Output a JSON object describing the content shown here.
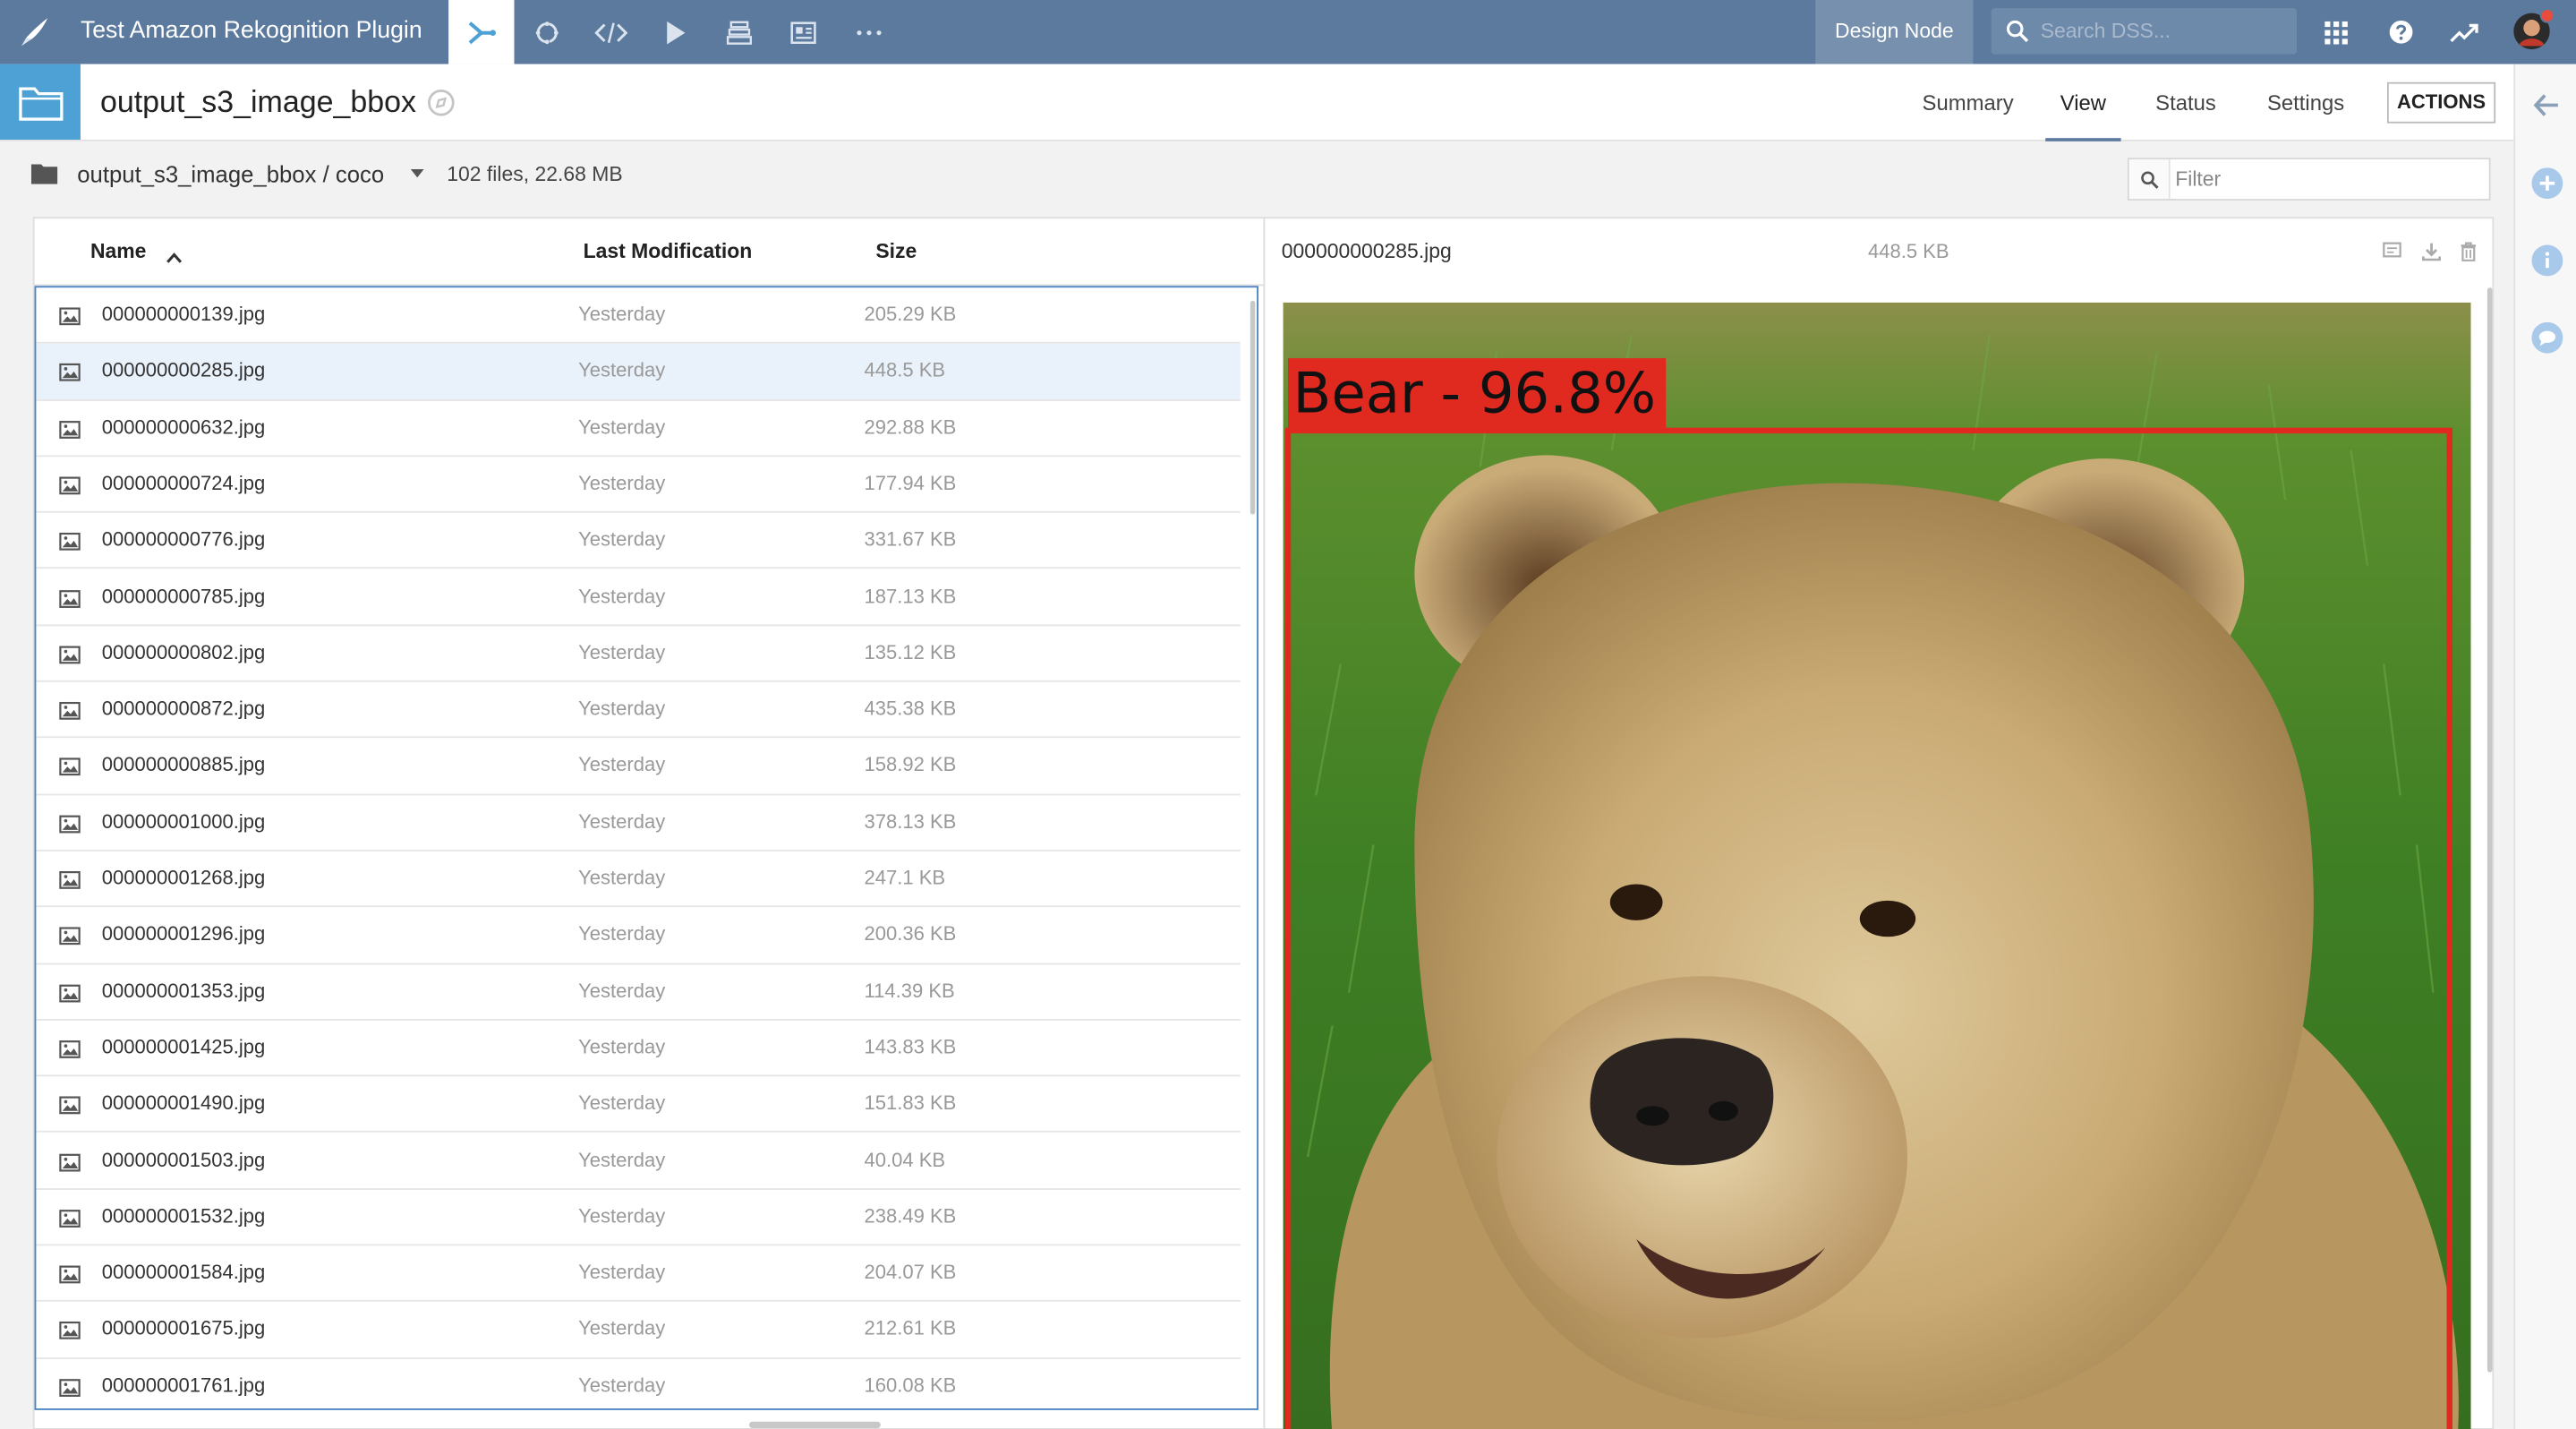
{
  "topbar": {
    "project_title": "Test Amazon Rekognition Plugin",
    "nav_icons": [
      "flow-icon",
      "recycle-icon",
      "code-icon",
      "play-icon",
      "stack-icon",
      "dashboard-icon",
      "more-icon"
    ],
    "design_node": "Design Node",
    "search_placeholder": "Search DSS..."
  },
  "header": {
    "title": "output_s3_image_bbox",
    "tabs": [
      {
        "label": "Summary"
      },
      {
        "label": "View"
      },
      {
        "label": "Status"
      },
      {
        "label": "Settings"
      }
    ],
    "active_tab": "View",
    "actions_label": "ACTIONS"
  },
  "pathbar": {
    "path": "output_s3_image_bbox / coco",
    "file_count": "102 files, 22.68 MB",
    "filter_placeholder": "Filter"
  },
  "list": {
    "columns": {
      "name": "Name",
      "last_modification": "Last Modification",
      "size": "Size"
    },
    "selected_index": 1,
    "files": [
      {
        "name": "000000000139.jpg",
        "modified": "Yesterday",
        "size": "205.29 KB"
      },
      {
        "name": "000000000285.jpg",
        "modified": "Yesterday",
        "size": "448.5 KB"
      },
      {
        "name": "000000000632.jpg",
        "modified": "Yesterday",
        "size": "292.88 KB"
      },
      {
        "name": "000000000724.jpg",
        "modified": "Yesterday",
        "size": "177.94 KB"
      },
      {
        "name": "000000000776.jpg",
        "modified": "Yesterday",
        "size": "331.67 KB"
      },
      {
        "name": "000000000785.jpg",
        "modified": "Yesterday",
        "size": "187.13 KB"
      },
      {
        "name": "000000000802.jpg",
        "modified": "Yesterday",
        "size": "135.12 KB"
      },
      {
        "name": "000000000872.jpg",
        "modified": "Yesterday",
        "size": "435.38 KB"
      },
      {
        "name": "000000000885.jpg",
        "modified": "Yesterday",
        "size": "158.92 KB"
      },
      {
        "name": "000000001000.jpg",
        "modified": "Yesterday",
        "size": "378.13 KB"
      },
      {
        "name": "000000001268.jpg",
        "modified": "Yesterday",
        "size": "247.1 KB"
      },
      {
        "name": "000000001296.jpg",
        "modified": "Yesterday",
        "size": "200.36 KB"
      },
      {
        "name": "000000001353.jpg",
        "modified": "Yesterday",
        "size": "114.39 KB"
      },
      {
        "name": "000000001425.jpg",
        "modified": "Yesterday",
        "size": "143.83 KB"
      },
      {
        "name": "000000001490.jpg",
        "modified": "Yesterday",
        "size": "151.83 KB"
      },
      {
        "name": "000000001503.jpg",
        "modified": "Yesterday",
        "size": "40.04 KB"
      },
      {
        "name": "000000001532.jpg",
        "modified": "Yesterday",
        "size": "238.49 KB"
      },
      {
        "name": "000000001584.jpg",
        "modified": "Yesterday",
        "size": "204.07 KB"
      },
      {
        "name": "000000001675.jpg",
        "modified": "Yesterday",
        "size": "212.61 KB"
      },
      {
        "name": "000000001761.jpg",
        "modified": "Yesterday",
        "size": "160.08 KB"
      }
    ]
  },
  "preview": {
    "file_name": "000000000285.jpg",
    "file_size": "448.5 KB",
    "detection_label": "Bear - 96.8%",
    "box_color": "#e0291f"
  },
  "colors": {
    "topbar": "#5b7a9e",
    "accent": "#4ea1d4",
    "selected_row": "#e9f1fa"
  }
}
